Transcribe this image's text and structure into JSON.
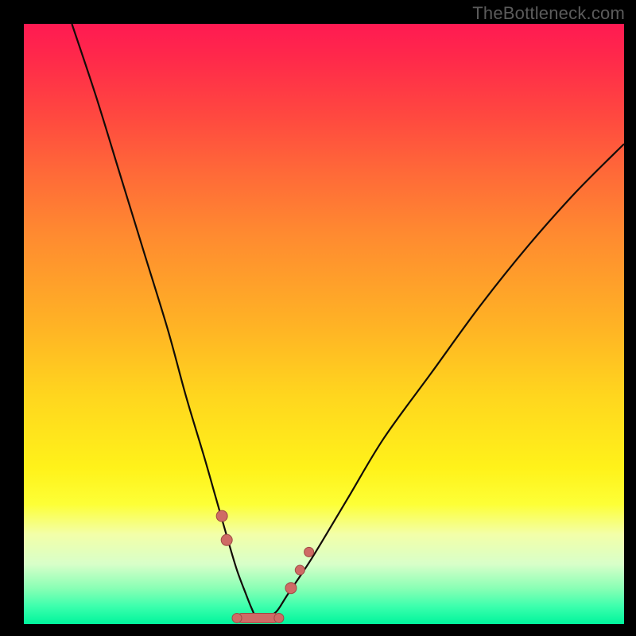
{
  "watermark": "TheBottleneck.com",
  "chart_data": {
    "type": "line",
    "title": "",
    "xlabel": "",
    "ylabel": "",
    "xlim": [
      0,
      100
    ],
    "ylim": [
      0,
      100
    ],
    "grid": false,
    "legend": false,
    "background_gradient": {
      "orientation": "vertical",
      "stops": [
        {
          "pos": 0,
          "color": "#ff1a52"
        },
        {
          "pos": 50,
          "color": "#ffb225"
        },
        {
          "pos": 80,
          "color": "#fdff36"
        },
        {
          "pos": 100,
          "color": "#00f59c"
        }
      ]
    },
    "series": [
      {
        "name": "bottleneck-curve",
        "color": "#000000",
        "x": [
          8,
          12,
          16,
          20,
          24,
          27,
          30,
          32,
          34,
          35.5,
          37,
          38,
          38.8,
          40,
          42,
          44,
          48,
          54,
          60,
          68,
          76,
          84,
          92,
          100
        ],
        "y": [
          100,
          88,
          75,
          62,
          49,
          38,
          28,
          21,
          14,
          9,
          5,
          2.5,
          1,
          1,
          2,
          5,
          11,
          21,
          31,
          42,
          53,
          63,
          72,
          80
        ]
      }
    ],
    "markers": [
      {
        "name": "left-bead-1",
        "x": 33.0,
        "y": 18,
        "r": 7
      },
      {
        "name": "left-bead-2",
        "x": 33.8,
        "y": 14,
        "r": 7
      },
      {
        "name": "bottom-bar",
        "type": "bar",
        "x0": 35.5,
        "x1": 42.5,
        "y": 1,
        "thickness": 12
      },
      {
        "name": "right-bead-1",
        "x": 44.5,
        "y": 6,
        "r": 7
      },
      {
        "name": "right-bead-2",
        "x": 46.0,
        "y": 9,
        "r": 6
      },
      {
        "name": "right-bead-3",
        "x": 47.5,
        "y": 12,
        "r": 6
      }
    ]
  }
}
